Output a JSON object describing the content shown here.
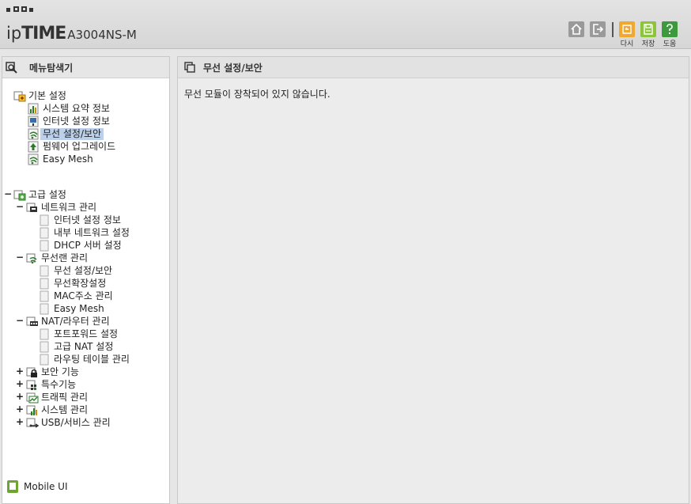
{
  "header": {
    "brand_ip": "ip",
    "brand_time": "TIME",
    "model": "A3004NS-M",
    "buttons": {
      "home_icon": "home-icon",
      "logout_icon": "logout-icon",
      "reload_label": "다시",
      "save_label": "저장",
      "help_label": "도움"
    },
    "colors": {
      "reload": "#f0a830",
      "save": "#8cc43c",
      "help": "#3c9a3c",
      "gray": "#9a9a9a"
    }
  },
  "menu": {
    "title": "메뉴탐색기",
    "basic": {
      "label": "기본 설정",
      "items": [
        {
          "label": "시스템 요약 정보",
          "icon": "chart-icon"
        },
        {
          "label": "인터넷 설정 정보",
          "icon": "monitor-icon"
        },
        {
          "label": "무선 설정/보안",
          "icon": "wifi-icon",
          "selected": true
        },
        {
          "label": "펌웨어 업그레이드",
          "icon": "upgrade-icon"
        },
        {
          "label": "Easy Mesh",
          "icon": "wifi-icon"
        }
      ]
    },
    "advanced": {
      "toggle": "−",
      "label": "고급 설정",
      "groups": [
        {
          "toggle": "−",
          "label": "네트워크 관리",
          "icon": "network-icon",
          "items": [
            "인터넷 설정 정보",
            "내부 네트워크 설정",
            "DHCP 서버 설정"
          ]
        },
        {
          "toggle": "−",
          "label": "무선랜 관리",
          "icon": "wifi-icon",
          "items": [
            "무선 설정/보안",
            "무선확장설정",
            "MAC주소 관리",
            "Easy Mesh"
          ]
        },
        {
          "toggle": "−",
          "label": "NAT/라우터 관리",
          "icon": "router-icon",
          "items": [
            "포트포워드 설정",
            "고급 NAT 설정",
            "라우팅 테이블 관리"
          ]
        }
      ],
      "collapsed": [
        {
          "toggle": "+",
          "label": "보안 기능",
          "icon": "lock-icon"
        },
        {
          "toggle": "+",
          "label": "특수기능",
          "icon": "special-icon"
        },
        {
          "toggle": "+",
          "label": "트래픽 관리",
          "icon": "traffic-icon"
        },
        {
          "toggle": "+",
          "label": "시스템 관리",
          "icon": "chart-icon"
        },
        {
          "toggle": "+",
          "label": "USB/서비스 관리",
          "icon": "usb-icon"
        }
      ]
    },
    "mobile_ui": "Mobile UI"
  },
  "content": {
    "title": "무선 설정/보안",
    "message": "무선 모듈이 장착되어 있지 않습니다."
  }
}
